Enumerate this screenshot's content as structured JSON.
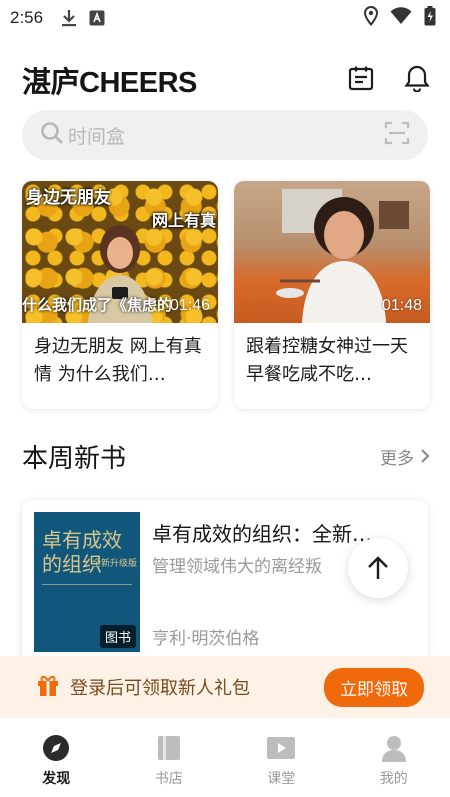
{
  "status_bar": {
    "time": "2:56"
  },
  "header": {
    "logo": "湛庐CHEERS"
  },
  "search": {
    "placeholder": "时间盒"
  },
  "videos": [
    {
      "title": "身边无朋友 网上有真情 为什么我们…",
      "duration": "01:46",
      "thumb_text": [
        "身边无朋友",
        "网上有真",
        "什么我们成了《焦虑的"
      ]
    },
    {
      "title": "跟着控糖女神过一天 早餐吃咸不吃…",
      "duration": "01:48"
    }
  ],
  "new_books": {
    "title": "本周新书",
    "more": "更多",
    "book": {
      "title": "卓有成效的组织：全新…",
      "desc": "管理领域伟大的离经叛",
      "author": "亨利·明茨伯格",
      "tag": "图书",
      "cover_title": "卓有成效的组织",
      "cover_subtitle": "全新升级版"
    }
  },
  "promo": {
    "text": "登录后可领取新人礼包",
    "cta": "立即领取"
  },
  "tabs": [
    {
      "label": "发现",
      "icon": "compass-icon",
      "active": true
    },
    {
      "label": "书店",
      "icon": "book-icon",
      "active": false
    },
    {
      "label": "课堂",
      "icon": "play-icon",
      "active": false
    },
    {
      "label": "我的",
      "icon": "user-icon",
      "active": false
    }
  ],
  "colors": {
    "accent": "#f0690b",
    "promo_bg": "#fdf2e5",
    "cover_bg": "#11577c"
  }
}
